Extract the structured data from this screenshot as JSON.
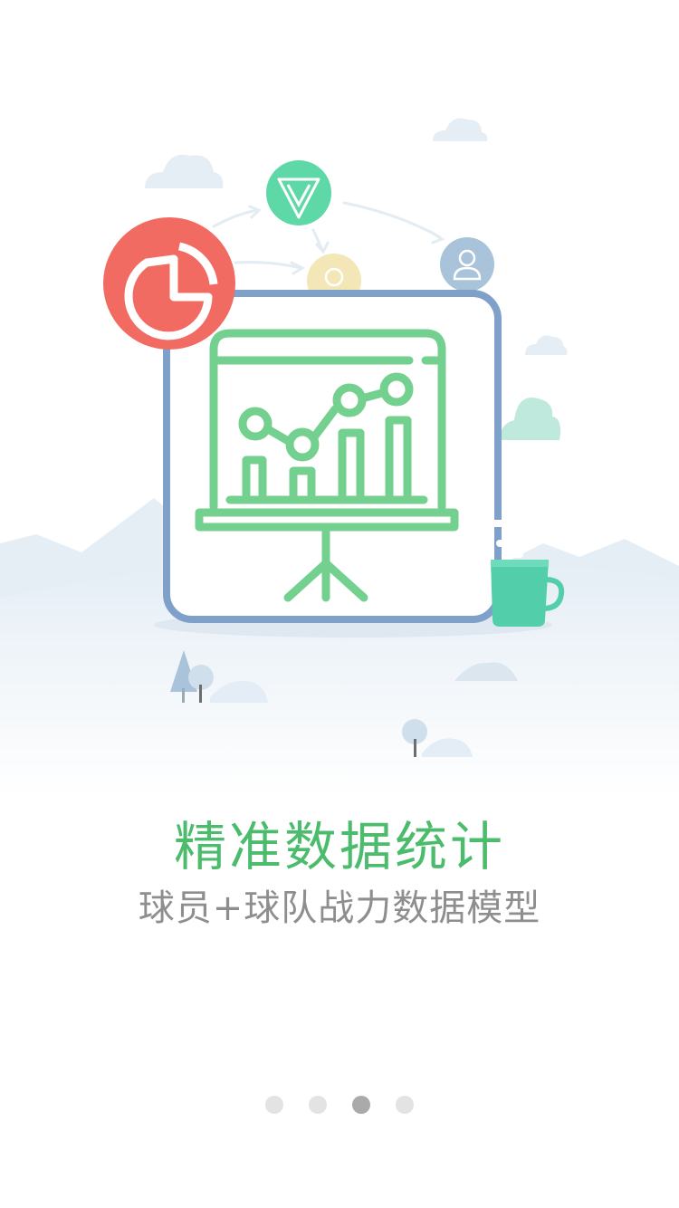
{
  "onboarding": {
    "title": "精准数据统计",
    "subtitle": "球员+球队战力数据模型",
    "pages": 4,
    "active_page": 3
  },
  "colors": {
    "title": "#4bbb6c",
    "subtitle": "#8e8e8e",
    "frame": "#7fa0c8",
    "board": "#74d08e",
    "pie_icon": "#f26b62",
    "mug": "#52cfaa",
    "dot_active": "#aaaaaa",
    "dot_inactive": "#e3e3e3"
  },
  "icons": [
    "pie-chart-icon",
    "presentation-board-icon",
    "triangle-logo-icon",
    "user-icon",
    "coin-icon",
    "coffee-mug-icon"
  ]
}
